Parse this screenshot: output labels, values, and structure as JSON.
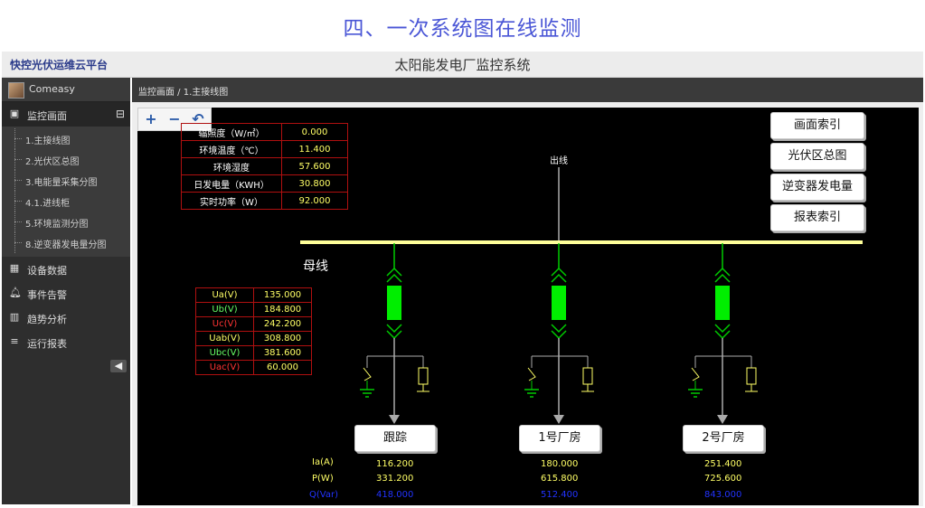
{
  "page_title": "四、一次系统图在线监测",
  "brand": "快控光伏运维云平台",
  "system_title": "太阳能发电厂监控系统",
  "user": {
    "name": "Comeasy"
  },
  "menu": {
    "monitor": "监控画面",
    "sub": [
      "1.主接线图",
      "2.光伏区总图",
      "3.电能量采集分图",
      "4.1.进线柜",
      "5.环境监测分图",
      "8.逆变器发电量分图"
    ],
    "device_data": "设备数据",
    "event_alarm": "事件告警",
    "trend": "趋势分析",
    "report": "运行报表"
  },
  "breadcrumb": "监控画面 / 1.主接线图",
  "zoom": {
    "in": "+",
    "out": "−",
    "reset": "↶"
  },
  "nav_buttons": [
    "画面索引",
    "光伏区总图",
    "逆变器发电量",
    "报表索引"
  ],
  "env_table": [
    {
      "label": "辐照度（W/㎡）",
      "value": "0.000"
    },
    {
      "label": "环境温度（℃）",
      "value": "11.400"
    },
    {
      "label": "环境湿度",
      "value": "57.600"
    },
    {
      "label": "日发电量（KWH）",
      "value": "30.800"
    },
    {
      "label": "实时功率（W）",
      "value": "92.000"
    }
  ],
  "volt_table": [
    {
      "label": "Ua(V)",
      "value": "135.000"
    },
    {
      "label": "Ub(V)",
      "value": "184.800"
    },
    {
      "label": "Uc(V)",
      "value": "242.200"
    },
    {
      "label": "Uab(V)",
      "value": "308.800"
    },
    {
      "label": "Ubc(V)",
      "value": "381.600"
    },
    {
      "label": "Uac(V)",
      "value": "60.000"
    }
  ],
  "diagram": {
    "bus_label": "母线",
    "out_label": "出线",
    "feeders": [
      "跟踪",
      "1号厂房",
      "2号厂房"
    ]
  },
  "measurements": {
    "labels": [
      "Ia(A)",
      "P(W)",
      "Q(Var)"
    ],
    "feeder_values": [
      [
        "116.200",
        "331.200",
        "418.000"
      ],
      [
        "180.000",
        "615.800",
        "512.400"
      ],
      [
        "251.400",
        "725.600",
        "843.000"
      ]
    ]
  },
  "colors": {
    "accent_title": "#4a56d6",
    "bus": "#ffff99",
    "breaker": "#00ee00",
    "feeder_line": "#aaaaaa",
    "table_border": "#b01010",
    "q_value": "#2233ff"
  }
}
